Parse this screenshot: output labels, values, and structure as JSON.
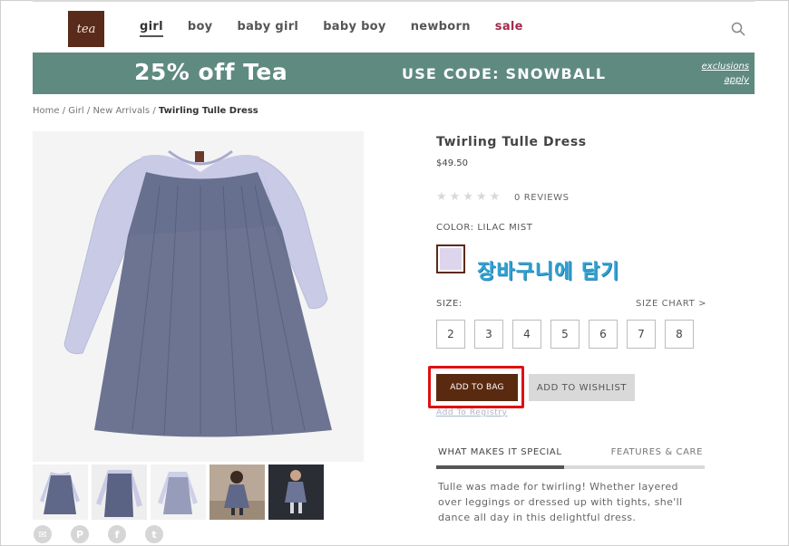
{
  "header": {
    "logo_text": "tea",
    "nav": [
      {
        "label": "girl",
        "active": true
      },
      {
        "label": "boy"
      },
      {
        "label": "baby girl"
      },
      {
        "label": "baby boy"
      },
      {
        "label": "newborn"
      },
      {
        "label": "sale",
        "color": "#a42a4d"
      }
    ],
    "search_icon": "search-icon"
  },
  "banner": {
    "promo": "25% off Tea",
    "code": "USE CODE: SNOWBALL",
    "exclusions": "exclusions",
    "apply": "apply",
    "color": "#5f8a80"
  },
  "breadcrumb": {
    "items": [
      "Home",
      "Girl",
      "New Arrivals"
    ],
    "separator": "/",
    "current": "Twirling Tulle Dress"
  },
  "product": {
    "title": "Twirling Tulle Dress",
    "price": "$49.50",
    "rating_stars": 0,
    "reviews": "0 REVIEWS",
    "color_label": "COLOR: LILAC MIST",
    "swatch_color": "#dcd5ec",
    "annotation": "장바구니에 담기",
    "size_label": "SIZE:",
    "size_chart": "SIZE CHART >",
    "sizes": [
      "2",
      "3",
      "4",
      "5",
      "6",
      "7",
      "8"
    ],
    "add_to_bag": "ADD TO BAG",
    "add_to_wishlist": "ADD TO WISHLIST",
    "registry": "Add To Registry",
    "tabs": [
      "WHAT MAKES IT SPECIAL",
      "FEATURES & CARE"
    ],
    "description": "Tulle was made for twirling! Whether layered over leggings or dressed up with tights, she'll dance all day in this delightful dress."
  },
  "share": {
    "icons": [
      "email-icon",
      "pinterest-icon",
      "facebook-icon",
      "twitter-icon"
    ]
  }
}
